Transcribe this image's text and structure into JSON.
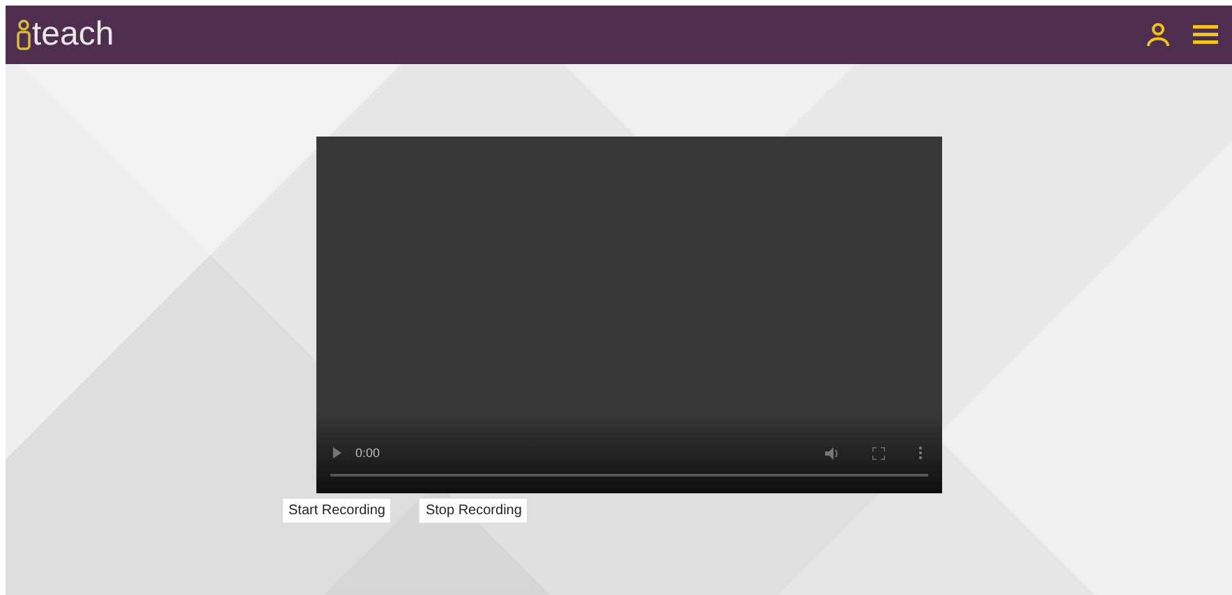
{
  "header": {
    "logo_text": "teach"
  },
  "video": {
    "time": "0:00",
    "progress": {
      "level": 0
    }
  },
  "buttons": [
    {
      "label": "Start Recording"
    },
    {
      "label": "Stop Recording"
    }
  ]
}
